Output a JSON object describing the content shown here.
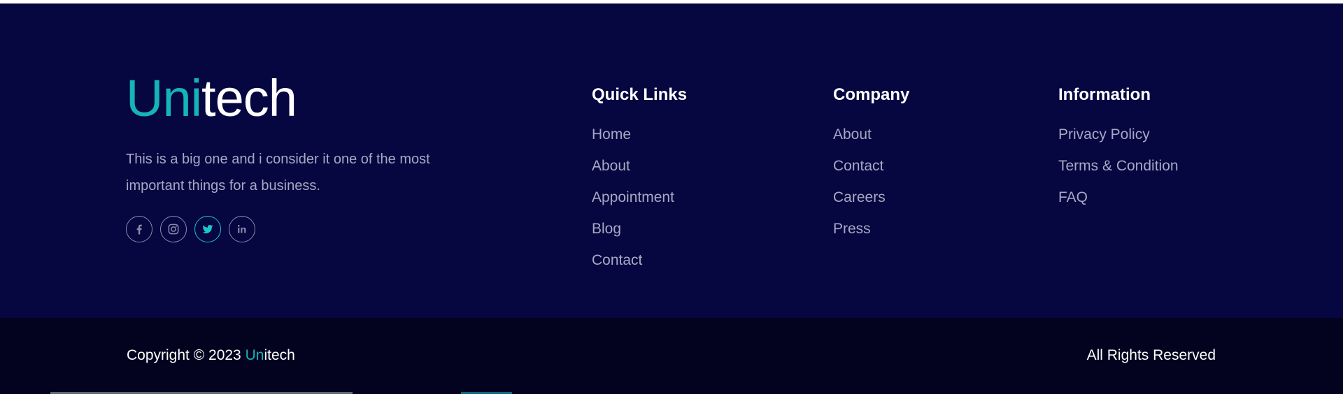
{
  "brand": {
    "prefix": "Uni",
    "suffix": "tech"
  },
  "about": {
    "text": "This is a big one and i consider it one of the most important things for a business."
  },
  "socials": [
    {
      "icon": "facebook-icon"
    },
    {
      "icon": "instagram-icon"
    },
    {
      "icon": "twitter-icon"
    },
    {
      "icon": "linkedin-icon"
    }
  ],
  "quick_links": {
    "title": "Quick Links",
    "items": [
      "Home",
      "About",
      "Appointment",
      "Blog",
      "Contact"
    ]
  },
  "company": {
    "title": "Company",
    "items": [
      "About",
      "Contact",
      "Careers",
      "Press"
    ]
  },
  "information": {
    "title": "Information",
    "items": [
      "Privacy Policy",
      "Terms & Condition",
      "FAQ"
    ]
  },
  "bottom": {
    "copyright_prefix": "Copyright © 2023 ",
    "brand_prefix": "Un",
    "brand_suffix": "itech",
    "rights": "All Rights Reserved"
  },
  "colors": {
    "background": "#060641",
    "bottom_bar": "#03021f",
    "accent": "#16b3b8",
    "link": "#a6a9c3"
  }
}
